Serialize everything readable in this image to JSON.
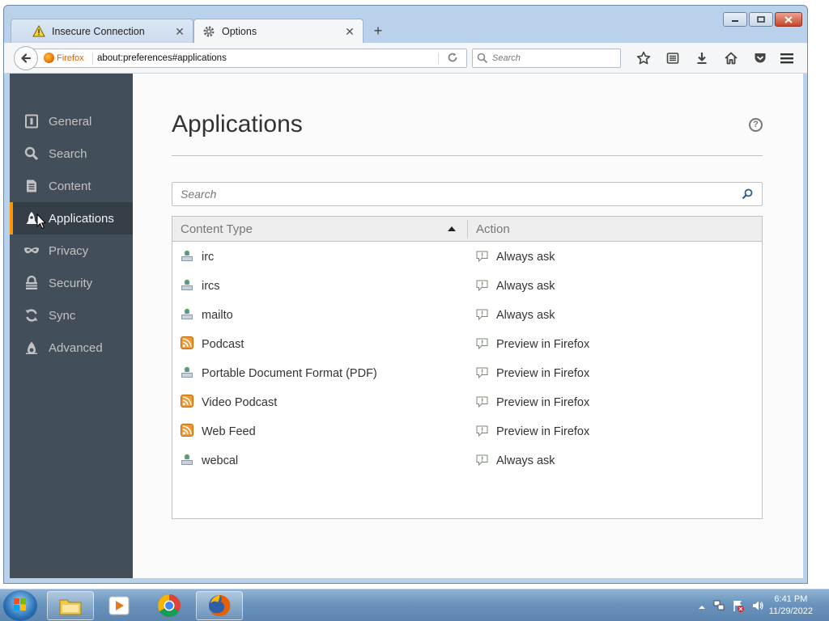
{
  "tabs": [
    {
      "label": "Insecure Connection",
      "icon": "warning-icon",
      "active": false
    },
    {
      "label": "Options",
      "icon": "gear-icon",
      "active": true
    }
  ],
  "new_tab_symbol": "+",
  "tab_close_symbol": "✕",
  "toolbar": {
    "identity": "Firefox",
    "url": "about:preferences#applications",
    "search_placeholder": "Search"
  },
  "sidebar": {
    "items": [
      {
        "label": "General",
        "icon": "general-icon"
      },
      {
        "label": "Search",
        "icon": "search-icon"
      },
      {
        "label": "Content",
        "icon": "content-icon"
      },
      {
        "label": "Applications",
        "icon": "applications-icon",
        "selected": true
      },
      {
        "label": "Privacy",
        "icon": "privacy-mask-icon"
      },
      {
        "label": "Security",
        "icon": "security-lock-icon"
      },
      {
        "label": "Sync",
        "icon": "sync-icon"
      },
      {
        "label": "Advanced",
        "icon": "advanced-icon"
      }
    ]
  },
  "main": {
    "heading": "Applications",
    "help_symbol": "?",
    "filter_placeholder": "Search",
    "columns": {
      "type": "Content Type",
      "action": "Action"
    },
    "rows": [
      {
        "type": "irc",
        "type_icon": "application-icon",
        "action": "Always ask"
      },
      {
        "type": "ircs",
        "type_icon": "application-icon",
        "action": "Always ask"
      },
      {
        "type": "mailto",
        "type_icon": "application-icon",
        "action": "Always ask"
      },
      {
        "type": "Podcast",
        "type_icon": "feed-icon",
        "action": "Preview in Firefox"
      },
      {
        "type": "Portable Document Format (PDF)",
        "type_icon": "application-icon",
        "action": "Preview in Firefox"
      },
      {
        "type": "Video Podcast",
        "type_icon": "feed-icon",
        "action": "Preview in Firefox"
      },
      {
        "type": "Web Feed",
        "type_icon": "feed-icon",
        "action": "Preview in Firefox"
      },
      {
        "type": "webcal",
        "type_icon": "application-icon",
        "action": "Always ask"
      }
    ]
  },
  "taskbar": {
    "time": "6:41 PM",
    "date": "11/29/2022"
  },
  "colors": {
    "sidebar_bg": "#424f5a",
    "sidebar_selected_bg": "#343f48",
    "accent": "#ff9500",
    "firefox_orange": "#e66000"
  }
}
